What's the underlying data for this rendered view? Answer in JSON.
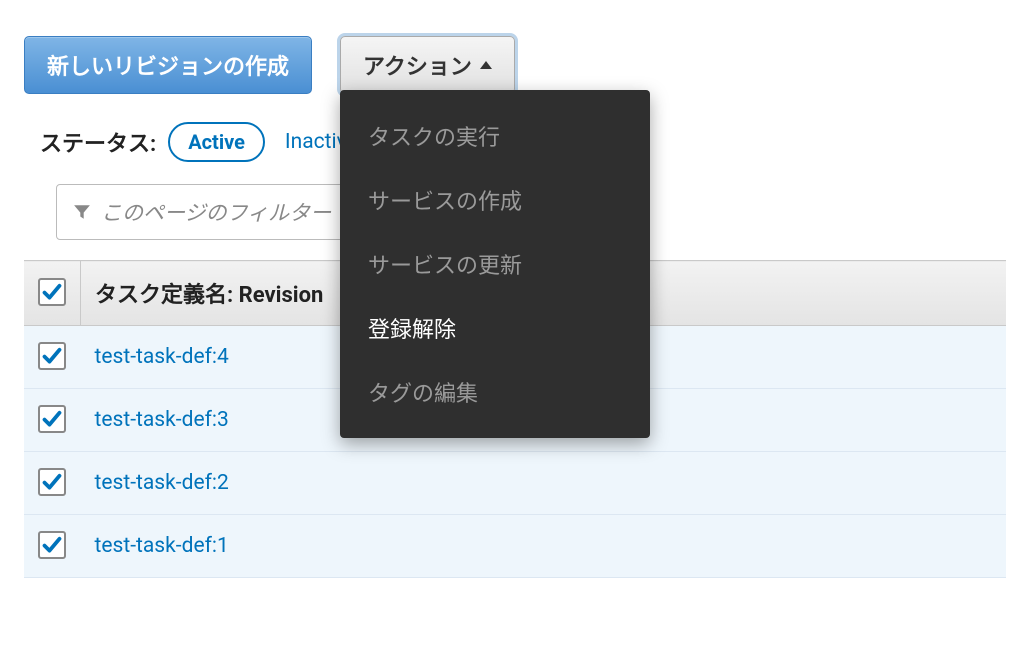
{
  "toolbar": {
    "create_revision_label": "新しいリビジョンの作成",
    "action_label": "アクション"
  },
  "dropdown": {
    "items": [
      {
        "label": "タスクの実行",
        "enabled": false
      },
      {
        "label": "サービスの作成",
        "enabled": false
      },
      {
        "label": "サービスの更新",
        "enabled": false
      },
      {
        "label": "登録解除",
        "enabled": true
      },
      {
        "label": "タグの編集",
        "enabled": false
      }
    ]
  },
  "status": {
    "label": "ステータス:",
    "active": "Active",
    "inactive": "Inactive"
  },
  "filter": {
    "placeholder": "このページのフィルター"
  },
  "table": {
    "header": "タスク定義名: Revision",
    "rows": [
      {
        "name": "test-task-def:4",
        "checked": true
      },
      {
        "name": "test-task-def:3",
        "checked": true
      },
      {
        "name": "test-task-def:2",
        "checked": true
      },
      {
        "name": "test-task-def:1",
        "checked": true
      }
    ],
    "all_checked": true
  }
}
